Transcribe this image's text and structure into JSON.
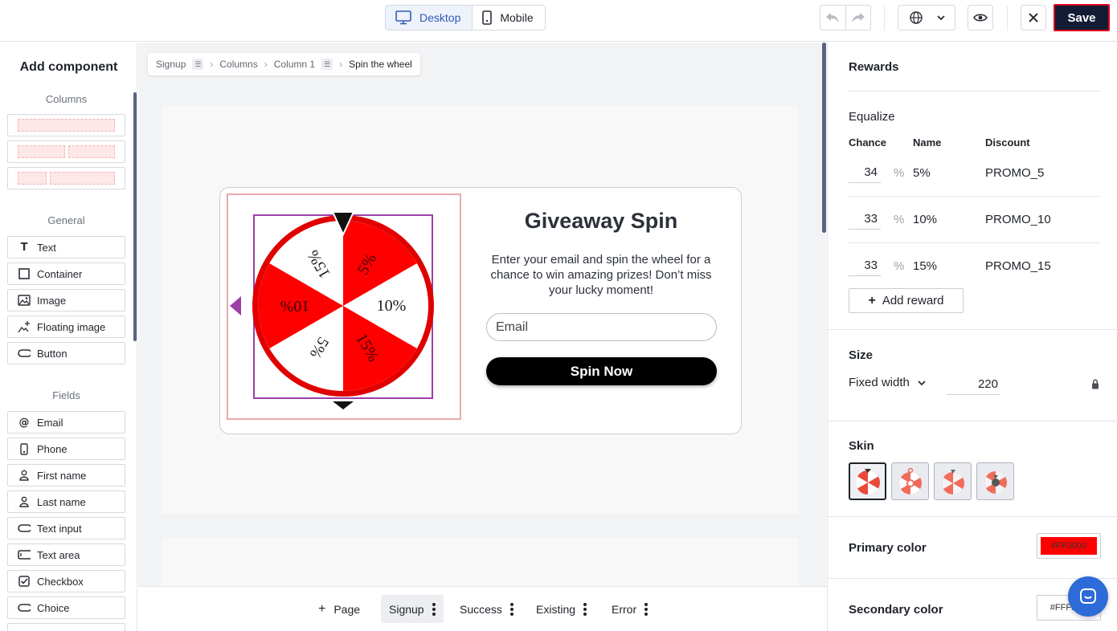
{
  "topbar": {
    "desktop_label": "Desktop",
    "mobile_label": "Mobile",
    "save_label": "Save"
  },
  "sidebar": {
    "title": "Add component",
    "sections": {
      "columns": "Columns",
      "general": "General",
      "fields": "Fields"
    },
    "general_items": [
      "Text",
      "Container",
      "Image",
      "Floating image",
      "Button"
    ],
    "field_items": [
      "Email",
      "Phone",
      "First name",
      "Last name",
      "Text input",
      "Text area",
      "Checkbox",
      "Choice"
    ]
  },
  "breadcrumb": [
    "Signup",
    "Columns",
    "Column 1",
    "Spin the wheel"
  ],
  "popup": {
    "title": "Giveaway Spin",
    "description": "Enter your email and spin the wheel for a chance to win amazing prizes! Don’t miss your lucky moment!",
    "email_placeholder": "Email",
    "button_label": "Spin Now",
    "wheel_labels": [
      "5%",
      "10%",
      "15%",
      "5%",
      "10%",
      "15%"
    ],
    "wheel_color": "#FF0000"
  },
  "pages": {
    "add_label": "Page",
    "tabs": [
      "Signup",
      "Success",
      "Existing",
      "Error"
    ],
    "active": "Signup"
  },
  "rewards": {
    "heading": "Rewards",
    "equalize_label": "Equalize",
    "columns": [
      "Chance",
      "Name",
      "Discount"
    ],
    "rows": [
      {
        "chance": "34",
        "name": "5%",
        "discount": "PROMO_5"
      },
      {
        "chance": "33",
        "name": "10%",
        "discount": "PROMO_10"
      },
      {
        "chance": "33",
        "name": "15%",
        "discount": "PROMO_15"
      }
    ],
    "percent_symbol": "%",
    "add_label": "Add reward"
  },
  "size": {
    "heading": "Size",
    "mode": "Fixed width",
    "value": "220"
  },
  "skin": {
    "heading": "Skin"
  },
  "colors": {
    "primary_label": "Primary color",
    "primary_value": "#FF0000",
    "secondary_label": "Secondary color",
    "secondary_value": "#FFFFFF"
  }
}
